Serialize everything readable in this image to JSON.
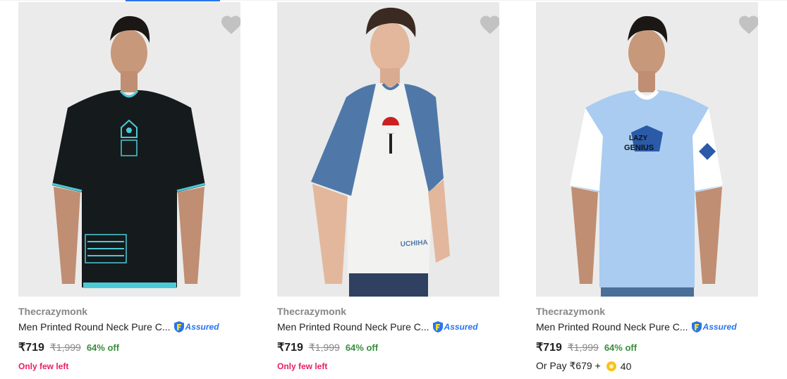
{
  "products": [
    {
      "brand": "Thecrazymonk",
      "title": "Men Printed Round Neck Pure C...",
      "assured": "Assured",
      "price": "₹719",
      "mrp": "₹1,999",
      "discount": "64% off",
      "stock_note": "Only few left",
      "shirt_color": "#151a1c",
      "accent_color": "#4cc9d6"
    },
    {
      "brand": "Thecrazymonk",
      "title": "Men Printed Round Neck Pure C...",
      "assured": "Assured",
      "price": "₹719",
      "mrp": "₹1,999",
      "discount": "64% off",
      "stock_note": "Only few left",
      "shirt_color": "#f2f2f0",
      "accent_color": "#4f78a8"
    },
    {
      "brand": "Thecrazymonk",
      "title": "Men Printed Round Neck Pure C...",
      "assured": "Assured",
      "price": "₹719",
      "mrp": "₹1,999",
      "discount": "64% off",
      "pay_with_coins": {
        "prefix": "Or Pay ₹679 +",
        "coins": "40"
      },
      "shirt_color": "#a9ccf0",
      "accent_color": "#ffffff"
    }
  ],
  "colors": {
    "green": "#388e3c",
    "pink": "#e91e63",
    "grey": "#878787",
    "blue": "#2874f0"
  }
}
